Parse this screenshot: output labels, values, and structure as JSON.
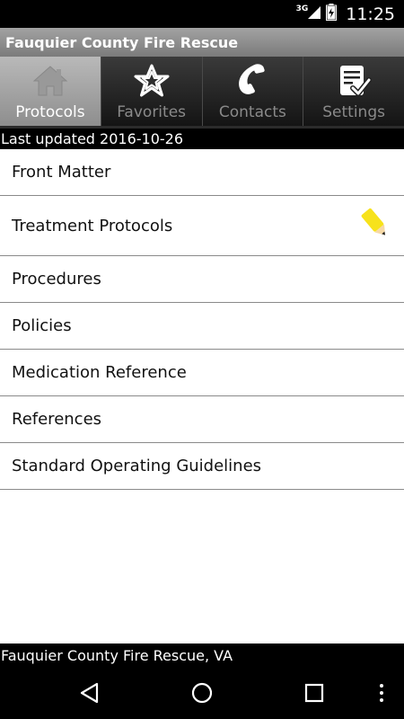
{
  "status_bar": {
    "network": "3G",
    "time": "11:25"
  },
  "app_title": "Fauquier County Fire Rescue",
  "tabs": [
    {
      "label": "Protocols",
      "icon": "house-icon",
      "active": true
    },
    {
      "label": "Favorites",
      "icon": "star-icon",
      "active": false
    },
    {
      "label": "Contacts",
      "icon": "phone-icon",
      "active": false
    },
    {
      "label": "Settings",
      "icon": "checklist-icon",
      "active": false
    }
  ],
  "last_updated": "Last updated 2016-10-26",
  "menu": [
    {
      "label": "Front Matter"
    },
    {
      "label": "Treatment Protocols",
      "icon": "highlighter-pencil-icon"
    },
    {
      "label": "Procedures"
    },
    {
      "label": "Policies"
    },
    {
      "label": "Medication Reference"
    },
    {
      "label": "References"
    },
    {
      "label": "Standard Operating Guidelines"
    }
  ],
  "footer_text": "Fauquier County Fire Rescue, VA",
  "colors": {
    "highlight_yellow": "#f7e21b",
    "active_tab": "#a5a5a5",
    "header": "#8e8e8e"
  }
}
